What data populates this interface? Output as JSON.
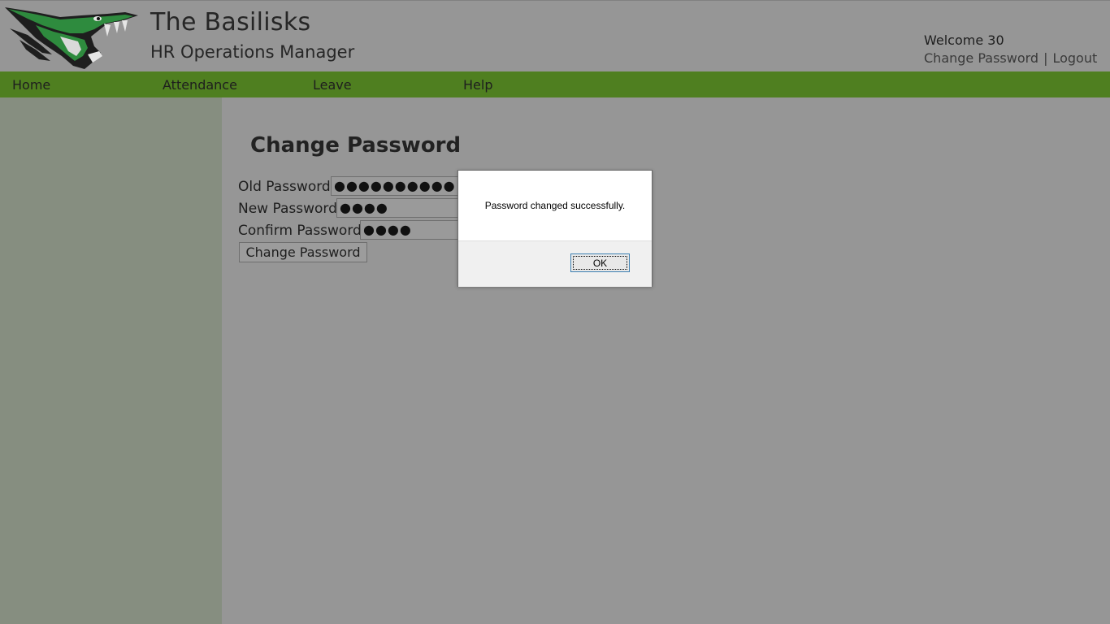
{
  "header": {
    "title": "The Basilisks",
    "subtitle": "HR Operations Manager",
    "welcome": "Welcome 30",
    "change_password_link": "Change Password",
    "separator": "|",
    "logout_link": "Logout"
  },
  "nav": {
    "items": [
      {
        "label": "Home"
      },
      {
        "label": "Attendance"
      },
      {
        "label": "Leave"
      },
      {
        "label": "Help"
      }
    ]
  },
  "form": {
    "title": "Change Password",
    "old_password_label": "Old Password",
    "old_password_value": "●●●●●●●●●●",
    "new_password_label": "New Password",
    "new_password_value": "●●●●",
    "confirm_password_label": "Confirm Password",
    "confirm_password_value": "●●●●",
    "submit_label": "Change Password"
  },
  "dialog": {
    "message": "Password changed successfully.",
    "ok_label": "OK"
  },
  "colors": {
    "nav_bar": "#4f7f20",
    "sidebar": "#868e80",
    "background": "#969696",
    "logo_green": "#2e8b3e"
  },
  "icons": {
    "logo": "basilisk-serpent-logo"
  }
}
